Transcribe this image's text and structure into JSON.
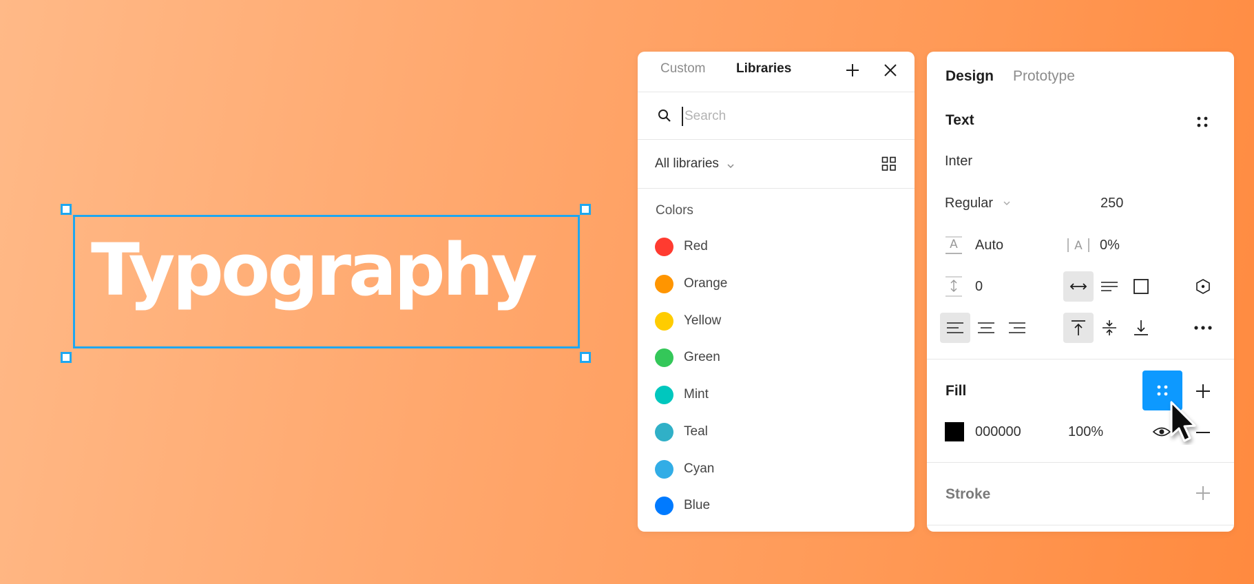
{
  "canvas": {
    "text": "Typography"
  },
  "libraries_panel": {
    "tabs": [
      {
        "label": "Custom",
        "active": false
      },
      {
        "label": "Libraries",
        "active": true
      }
    ],
    "search": {
      "placeholder": "Search",
      "value": ""
    },
    "filter_label": "All libraries",
    "section_title": "Colors",
    "colors": [
      {
        "name": "Red",
        "hex": "#ff3b30"
      },
      {
        "name": "Orange",
        "hex": "#ff9500"
      },
      {
        "name": "Yellow",
        "hex": "#ffcc00"
      },
      {
        "name": "Green",
        "hex": "#34c759"
      },
      {
        "name": "Mint",
        "hex": "#00c7be"
      },
      {
        "name": "Teal",
        "hex": "#30b0c7"
      },
      {
        "name": "Cyan",
        "hex": "#32ade6"
      },
      {
        "name": "Blue",
        "hex": "#007aff"
      }
    ]
  },
  "design_panel": {
    "tabs": [
      {
        "label": "Design",
        "active": true
      },
      {
        "label": "Prototype",
        "active": false
      }
    ],
    "text_section": {
      "title": "Text",
      "font_family": "Inter",
      "font_weight": "Regular",
      "font_size": "250",
      "line_height": "Auto",
      "letter_spacing": "0%",
      "paragraph_spacing": "0"
    },
    "fill_section": {
      "title": "Fill",
      "hex": "000000",
      "opacity": "100%",
      "swatch_color": "#000000"
    },
    "stroke_section": {
      "title": "Stroke"
    }
  },
  "accent_color": "#1ea7f0",
  "highlight_button_color": "#0d99ff"
}
